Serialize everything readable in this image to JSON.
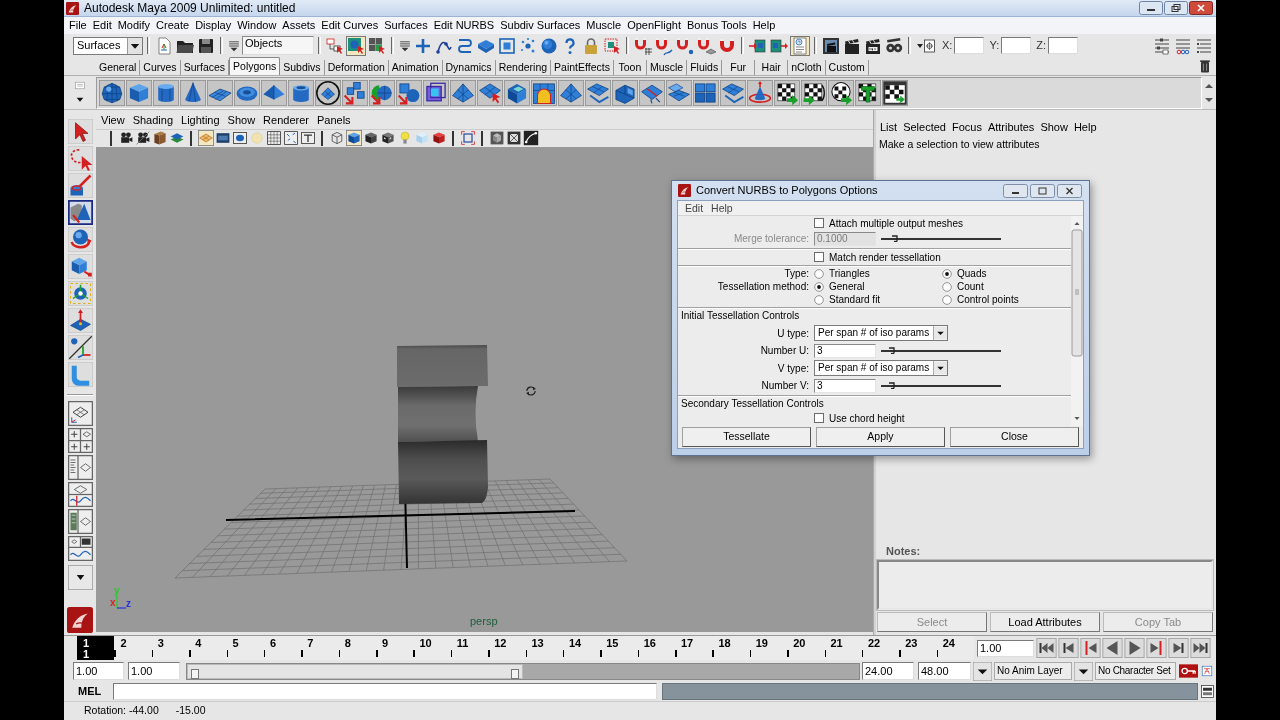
{
  "window": {
    "title": "Autodesk Maya 2009 Unlimited: untitled"
  },
  "menu_bar": [
    "File",
    "Edit",
    "Modify",
    "Create",
    "Display",
    "Window",
    "Assets",
    "Edit Curves",
    "Surfaces",
    "Edit NURBS",
    "Subdiv Surfaces",
    "Muscle",
    "OpenFlight",
    "Bonus Tools",
    "Help"
  ],
  "status_line": {
    "menu_set": "Surfaces",
    "selection_field": "Objects",
    "selection_modes": [
      {
        "selected": false
      },
      {
        "selected": true
      },
      {
        "selected": false
      }
    ],
    "construction_history": {
      "on": true
    },
    "coordinate_labels": [
      "X:",
      "Y:",
      "Z:"
    ]
  },
  "shelf_tabs": [
    {
      "label": "General",
      "selected": false
    },
    {
      "label": "Curves",
      "selected": false
    },
    {
      "label": "Surfaces",
      "selected": false
    },
    {
      "label": "Polygons",
      "selected": true
    },
    {
      "label": "Subdivs",
      "selected": false
    },
    {
      "label": "Deformation",
      "selected": false
    },
    {
      "label": "Animation",
      "selected": false
    },
    {
      "label": "Dynamics",
      "selected": false
    },
    {
      "label": "Rendering",
      "selected": false
    },
    {
      "label": "PaintEffects",
      "selected": false
    },
    {
      "label": "Toon",
      "selected": false
    },
    {
      "label": "Muscle",
      "selected": false
    },
    {
      "label": "Fluids",
      "selected": false
    },
    {
      "label": "Fur",
      "selected": false
    },
    {
      "label": "Hair",
      "selected": false
    },
    {
      "label": "nCloth",
      "selected": false
    },
    {
      "label": "Custom",
      "selected": false
    }
  ],
  "toolbox": {
    "tools": [
      {
        "selected": false
      },
      {
        "selected": false
      },
      {
        "selected": false
      },
      {
        "selected": true
      },
      {
        "selected": false
      },
      {
        "selected": false
      },
      {
        "selected": false
      },
      {
        "selected": false
      },
      {
        "selected": false
      },
      {
        "selected": false
      }
    ]
  },
  "viewport": {
    "menu": [
      "View",
      "Shading",
      "Lighting",
      "Show",
      "Renderer",
      "Panels"
    ],
    "toolbar": [
      {
        "on": false
      },
      {
        "on": false
      },
      {
        "on": false
      },
      {
        "on": false
      },
      {
        "on": true
      },
      {
        "on": false
      },
      {
        "on": false
      },
      {
        "on": false
      },
      {
        "on": false
      },
      {
        "on": false
      },
      {
        "on": false
      },
      {
        "on": false
      },
      {
        "on": true
      },
      {
        "on": false
      },
      {
        "on": false
      },
      {
        "on": false
      },
      {
        "on": false
      },
      {
        "on": false
      },
      {
        "on": false
      },
      {
        "on": false
      },
      {
        "on": false
      },
      {
        "on": false
      }
    ],
    "axis_labels": [
      "y",
      "x",
      "z"
    ],
    "camera_label": "persp"
  },
  "attribute_editor": {
    "menu": [
      "List",
      "Selected",
      "Focus",
      "Attributes",
      "Show",
      "Help"
    ],
    "message": "Make a selection to view attributes",
    "notes_label": "Notes:",
    "buttons": [
      {
        "label": "Select",
        "disabled": true
      },
      {
        "label": "Load Attributes",
        "disabled": false
      },
      {
        "label": "Copy Tab",
        "disabled": true
      }
    ]
  },
  "dialog": {
    "title": "Convert NURBS to Polygons Options",
    "menu": [
      "Edit",
      "Help"
    ],
    "sections": [
      {
        "rows": [
          {
            "kind": "checkbox",
            "label": "Attach multiple output meshes",
            "checked": false
          },
          {
            "kind": "slider",
            "label": "Merge tolerance:",
            "value": "0.1000",
            "level": 0.12,
            "disabled": true
          }
        ]
      },
      {
        "rows": [
          {
            "kind": "checkbox",
            "label": "Match render tessellation",
            "checked": false
          }
        ]
      },
      {
        "rows": [
          {
            "kind": "radio",
            "label": "Type:",
            "options": [
              {
                "label": "Triangles",
                "selected": false
              },
              {
                "label": "Quads",
                "selected": true
              }
            ]
          },
          {
            "kind": "radio",
            "label": "Tessellation method:",
            "options": [
              {
                "label": "General",
                "selected": true
              },
              {
                "label": "Count",
                "selected": false
              },
              {
                "label": "Standard fit",
                "selected": false
              },
              {
                "label": "Control points",
                "selected": false
              }
            ]
          }
        ]
      },
      {
        "heading": "Initial Tessellation Controls",
        "rows": [
          {
            "kind": "dropdown",
            "label": "U type:",
            "value": "Per span # of iso params"
          },
          {
            "kind": "slider",
            "label": "Number U:",
            "value": "3",
            "level": 0.09,
            "disabled": false
          },
          {
            "kind": "dropdown",
            "label": "V type:",
            "value": "Per span # of iso params"
          },
          {
            "kind": "slider",
            "label": "Number V:",
            "value": "3",
            "level": 0.09,
            "disabled": false
          }
        ]
      },
      {
        "heading": "Secondary Tessellation Controls",
        "rows": [
          {
            "kind": "checkbox",
            "label": "Use chord height",
            "checked": false
          }
        ]
      }
    ],
    "buttons": [
      "Tessellate",
      "Apply",
      "Close"
    ]
  },
  "time_slider": {
    "frames": [
      {
        "label": "1",
        "selected": true
      },
      {
        "label": "2",
        "selected": false
      },
      {
        "label": "3",
        "selected": false
      },
      {
        "label": "4",
        "selected": false
      },
      {
        "label": "5",
        "selected": false
      },
      {
        "label": "6",
        "selected": false
      },
      {
        "label": "7",
        "selected": false
      },
      {
        "label": "8",
        "selected": false
      },
      {
        "label": "9",
        "selected": false
      },
      {
        "label": "10",
        "selected": false
      },
      {
        "label": "11",
        "selected": false
      },
      {
        "label": "12",
        "selected": false
      },
      {
        "label": "13",
        "selected": false
      },
      {
        "label": "14",
        "selected": false
      },
      {
        "label": "15",
        "selected": false
      },
      {
        "label": "16",
        "selected": false
      },
      {
        "label": "17",
        "selected": false
      },
      {
        "label": "18",
        "selected": false
      },
      {
        "label": "19",
        "selected": false
      },
      {
        "label": "20",
        "selected": false
      },
      {
        "label": "21",
        "selected": false
      },
      {
        "label": "22",
        "selected": false
      },
      {
        "label": "23",
        "selected": false
      },
      {
        "label": "24",
        "selected": false
      }
    ],
    "current_frame": "1",
    "current_time": "1.00"
  },
  "range_slider": {
    "start_time": "1.00",
    "playback_start": "1.00",
    "level": 0.5,
    "playback_end": "24.00",
    "end_time": "48.00",
    "anim_layer": "No Anim Layer",
    "character_set": "No Character Set"
  },
  "command_line": {
    "label": "MEL"
  },
  "help_line": [
    "Rotation: -44.00",
    "-15.00"
  ]
}
